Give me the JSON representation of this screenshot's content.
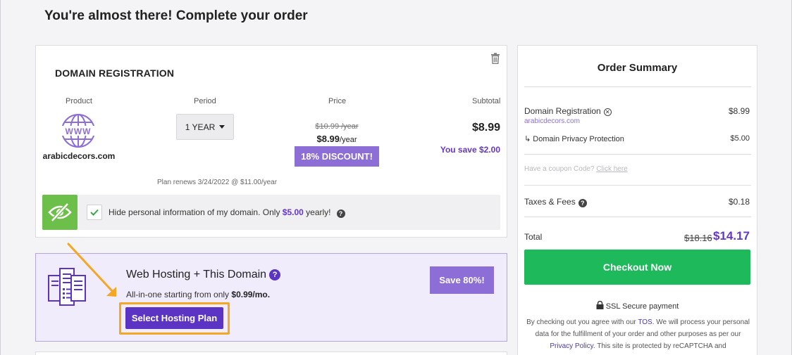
{
  "page": {
    "heading": "You're almost there! Complete your order"
  },
  "domain": {
    "title": "DOMAIN REGISTRATION",
    "columns": {
      "product": "Product",
      "period": "Period",
      "price": "Price",
      "subtotal": "Subtotal"
    },
    "domain_name": "arabicdecors.com",
    "www_label": "WWW",
    "period": "1 YEAR",
    "old_price": "$10.99 /year",
    "new_price": "$8.99",
    "price_unit": "/year",
    "discount": "18% DISCOUNT!",
    "subtotal": "$8.99",
    "you_save": "You save $2.00",
    "renews": "Plan renews 3/24/2022 @ $11.00/year",
    "privacy_text_before": "Hide personal information of my domain. Only ",
    "privacy_price": "$5.00",
    "privacy_text_after": " yearly!",
    "privacy_checked": true
  },
  "hosting": {
    "title": "Web Hosting + This Domain",
    "sub_before": "All-in-one starting from only ",
    "sub_price": "$0.99/mo.",
    "select_button": "Select Hosting Plan",
    "save_badge": "Save 80%!"
  },
  "summary": {
    "title": "Order Summary",
    "lines": [
      {
        "label": "Domain Registration",
        "value": "$8.99",
        "sub": "arabicdecors.com"
      },
      {
        "label": "↳ Domain Privacy Protection",
        "value": "$5.00"
      },
      {
        "label": "Taxes & Fees",
        "value": "$0.18"
      }
    ],
    "coupon_prompt": "Have a coupon Code? ",
    "coupon_link": "Click here",
    "total_label": "Total",
    "total_old": "$18.16",
    "total_new": "$14.17",
    "checkout_button": "Checkout Now",
    "ssl_text": "SSL Secure payment",
    "legal": {
      "p1": "By checking out you agree with our ",
      "tos": "TOS",
      "p2": ". We will process your personal data for the fulfillment of your order and other purposes as per our ",
      "privacy": "Privacy Policy",
      "p3": ". This site is protected by reCAPTCHA and"
    }
  },
  "colors": {
    "accent_purple": "#5c34c4",
    "badge_purple": "#8c6ed6",
    "checkout_green": "#1db95a",
    "privacy_green": "#6cc04a",
    "highlight_orange": "#f5a623"
  },
  "icons": {
    "trash": "trash-icon",
    "www": "www-globe-icon",
    "eye": "eye-slash-icon",
    "check": "check-icon",
    "help": "question-circle-icon",
    "server": "server-icon",
    "lock": "lock-icon",
    "remove": "x-circle-icon",
    "arrow": "annotation-arrow-icon"
  }
}
